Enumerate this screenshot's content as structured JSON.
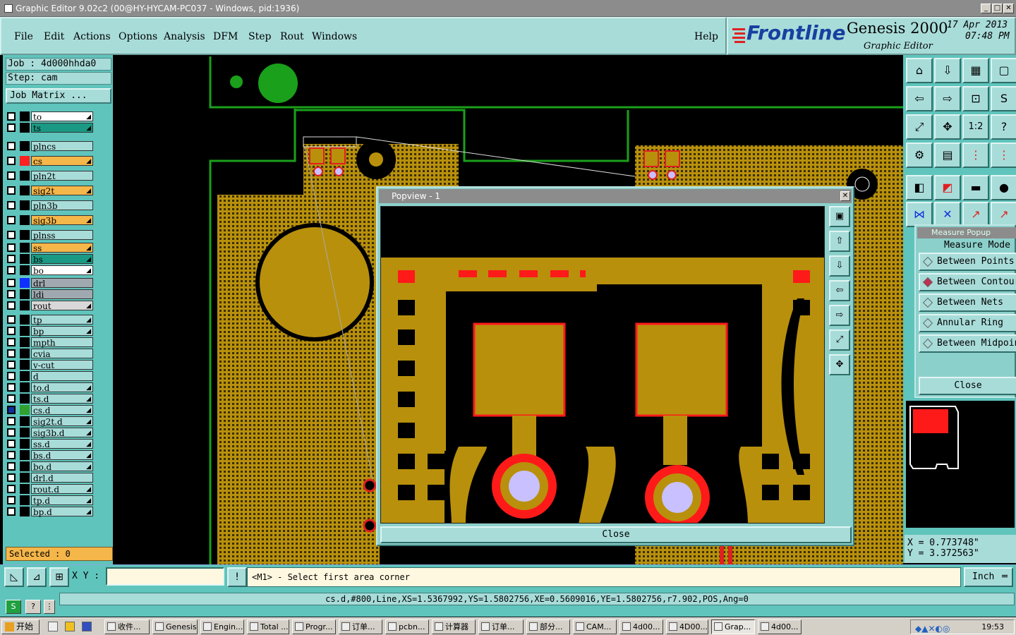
{
  "window": {
    "title": "Graphic Editor 9.02c2 (00@HY-HYCAM-PC037 - Windows, pid:1936)",
    "minimize": "_",
    "maximize": "□",
    "close": "✕"
  },
  "menu": {
    "items": [
      "File",
      "Edit",
      "Actions",
      "Options",
      "Analysis",
      "DFM",
      "Step",
      "Rout",
      "Windows"
    ],
    "help": "Help"
  },
  "brand": {
    "logo": "Frontline",
    "product": "Genesis 2000",
    "subtitle": "Graphic Editor",
    "date": "17 Apr 2013",
    "time": "07:48 PM"
  },
  "job": {
    "job_label": "Job  : 4d000hhda0",
    "step_label": "Step: cam",
    "matrix_button": "Job Matrix ..."
  },
  "layers": [
    {
      "name": "to",
      "color": "#ffffff",
      "swatch": "#000000",
      "arrow": true
    },
    {
      "name": "ts",
      "color": "#1a9a84",
      "swatch": "#000000",
      "arrow": true
    },
    {
      "name": "plncs",
      "color": "#a8dcd9",
      "swatch": "#000000",
      "arrow": false
    },
    {
      "name": "cs",
      "color": "#f5b64a",
      "swatch": "#ff2020",
      "arrow": true
    },
    {
      "name": "pln2t",
      "color": "#a8dcd9",
      "swatch": "#000000",
      "arrow": false
    },
    {
      "name": "sig2t",
      "color": "#f5b64a",
      "swatch": "#000000",
      "arrow": true
    },
    {
      "name": "pln3b",
      "color": "#a8dcd9",
      "swatch": "#000000",
      "arrow": false
    },
    {
      "name": "sig3b",
      "color": "#f5b64a",
      "swatch": "#000000",
      "arrow": true
    },
    {
      "name": "plnss",
      "color": "#a8dcd9",
      "swatch": "#000000",
      "arrow": false
    },
    {
      "name": "ss",
      "color": "#f5b64a",
      "swatch": "#000000",
      "arrow": true
    },
    {
      "name": "bs",
      "color": "#1a9a84",
      "swatch": "#000000",
      "arrow": true
    },
    {
      "name": "bo",
      "color": "#ffffff",
      "swatch": "#000000",
      "arrow": true
    },
    {
      "name": "drl",
      "color": "#a0a8b0",
      "swatch": "#1030ff",
      "arrow": false
    },
    {
      "name": "ldi",
      "color": "#a0a8b0",
      "swatch": "#000000",
      "arrow": false
    },
    {
      "name": "rout",
      "color": "#d8d8d8",
      "swatch": "#000000",
      "arrow": true
    },
    {
      "name": "tp",
      "color": "#a8dcd9",
      "swatch": "#000000",
      "arrow": true
    },
    {
      "name": "bp",
      "color": "#a8dcd9",
      "swatch": "#000000",
      "arrow": true
    },
    {
      "name": "mpth",
      "color": "#a8dcd9",
      "swatch": "#000000",
      "arrow": false
    },
    {
      "name": "cvia",
      "color": "#a8dcd9",
      "swatch": "#000000",
      "arrow": false
    },
    {
      "name": "v-cut",
      "color": "#a8dcd9",
      "swatch": "#000000",
      "arrow": false
    },
    {
      "name": "d",
      "color": "#a8dcd9",
      "swatch": "#000000",
      "arrow": false
    },
    {
      "name": "to.d",
      "color": "#a8dcd9",
      "swatch": "#000000",
      "arrow": true
    },
    {
      "name": "ts.d",
      "color": "#a8dcd9",
      "swatch": "#000000",
      "arrow": true
    },
    {
      "name": "cs.d",
      "color": "#a8dcd9",
      "swatch": "#30a030",
      "arrow": true
    },
    {
      "name": "sig2t.d",
      "color": "#a8dcd9",
      "swatch": "#000000",
      "arrow": true
    },
    {
      "name": "sig3b.d",
      "color": "#a8dcd9",
      "swatch": "#000000",
      "arrow": true
    },
    {
      "name": "ss.d",
      "color": "#a8dcd9",
      "swatch": "#000000",
      "arrow": true
    },
    {
      "name": "bs.d",
      "color": "#a8dcd9",
      "swatch": "#000000",
      "arrow": true
    },
    {
      "name": "bo.d",
      "color": "#a8dcd9",
      "swatch": "#000000",
      "arrow": true
    },
    {
      "name": "drl.d",
      "color": "#a8dcd9",
      "swatch": "#000000",
      "arrow": false
    },
    {
      "name": "rout.d",
      "color": "#a8dcd9",
      "swatch": "#000000",
      "arrow": true
    },
    {
      "name": "tp.d",
      "color": "#a8dcd9",
      "swatch": "#000000",
      "arrow": true
    },
    {
      "name": "bp.d",
      "color": "#a8dcd9",
      "swatch": "#000000",
      "arrow": true
    }
  ],
  "selected": "Selected : 0",
  "popview": {
    "title": "Popview - 1",
    "close": "Close"
  },
  "measure": {
    "title": "Measure Popup",
    "mode_label": "Measure Mode",
    "options": [
      {
        "label": "Between Points",
        "selected": false
      },
      {
        "label": "Between Contours",
        "selected": true
      },
      {
        "label": "Between Nets",
        "selected": false
      },
      {
        "label": "Annular Ring",
        "selected": false
      },
      {
        "label": "Between Midpoints",
        "selected": false
      }
    ],
    "close": "Close"
  },
  "coords": {
    "x": "X  =  0.773748\"",
    "y": "Y  =  3.372563\""
  },
  "command": {
    "xy_label": "X Y :",
    "xy_value": "",
    "prompt": "<M1> - Select first area corner",
    "unit": "Inch"
  },
  "status": "cs.d,#800,Line,XS=1.5367992,YS=1.5802756,XE=0.5609016,YE=1.5802756,r7.902,POS,Ang=0",
  "taskbar": {
    "start": "开始",
    "tasks": [
      "收件...",
      "Genesis",
      "Engin...",
      "Total ...",
      "Progr...",
      "订单...",
      "pcbn...",
      "计算器",
      "订单...",
      "部分...",
      "CAM...",
      "4d00...",
      "4D00...",
      "Grap...",
      "4d00..."
    ],
    "active_index": 13,
    "clock": "19:53"
  },
  "colors": {
    "copper": "#b8900c",
    "panel": "#5fc4bc",
    "button": "#a8dcd9",
    "outline": "#1aa01a",
    "highlight": "#ff1a1a",
    "drill": "#c8c0ff"
  }
}
